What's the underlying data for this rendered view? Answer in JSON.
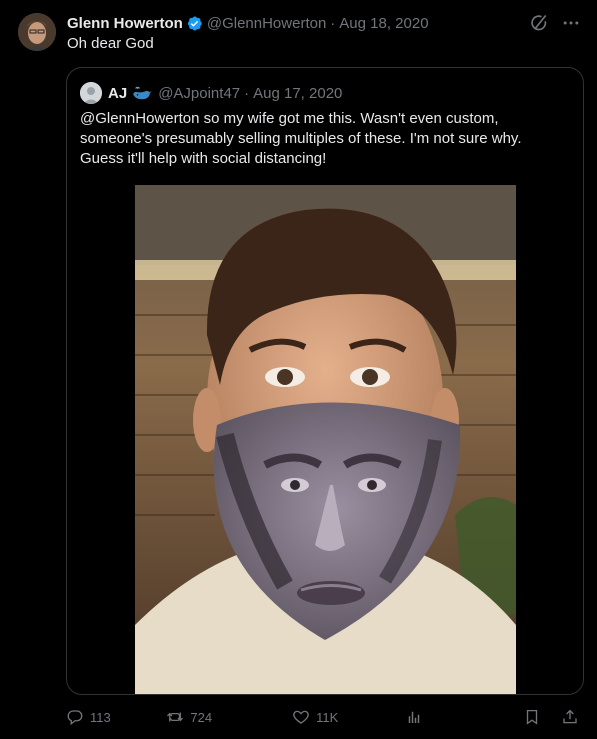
{
  "tweet": {
    "display_name": "Glenn Howerton",
    "handle": "@GlennHowerton",
    "separator": "·",
    "date": "Aug 18, 2020",
    "text": "Oh dear God"
  },
  "quote": {
    "display_name": "AJ",
    "handle": "@AJpoint47",
    "separator": "·",
    "date": "Aug 17, 2020",
    "text": "@GlennHowerton so my wife got me this. Wasn't even custom, someone's presumably selling multiples of these. I'm not sure why. Guess it'll help with social distancing!"
  },
  "actions": {
    "replies": "113",
    "retweets": "724",
    "likes": "11K"
  },
  "icons": [
    "verified-badge-icon",
    "grok-icon",
    "more-icon",
    "whale-emoji-icon",
    "reply-icon",
    "retweet-icon",
    "like-icon",
    "views-icon",
    "bookmark-icon",
    "share-icon"
  ],
  "colors": {
    "background": "#000000",
    "text": "#e7e9ea",
    "muted": "#71767b",
    "border": "#2f3336",
    "verified": "#1d9bf0"
  }
}
